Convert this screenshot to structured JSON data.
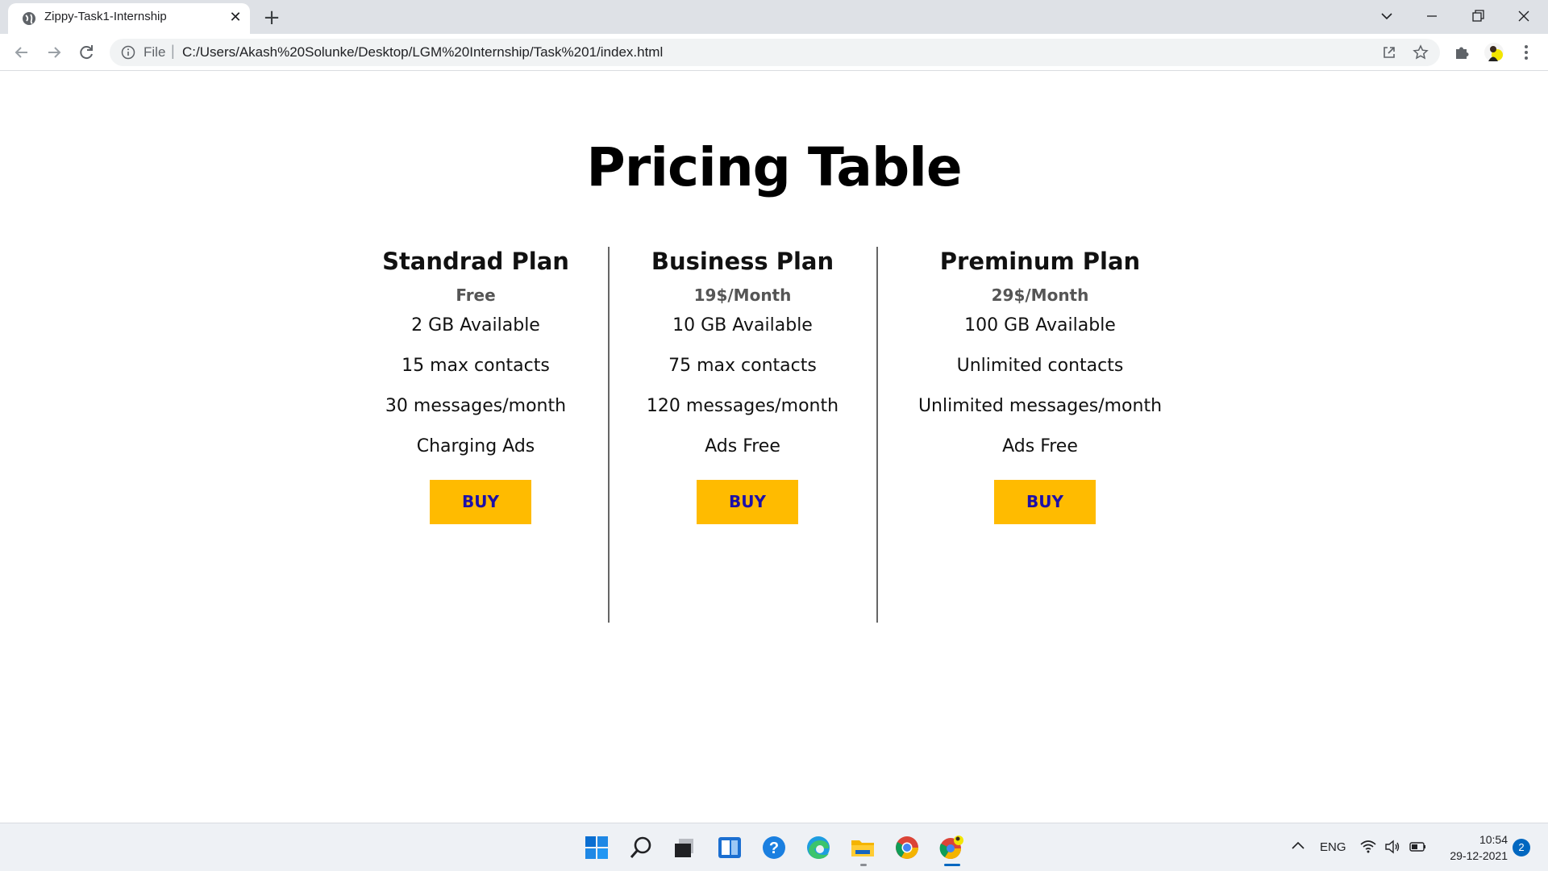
{
  "browser": {
    "tab_title": "Zippy-Task1-Internship",
    "tab_close": "✕",
    "new_tab": "+",
    "url_scheme": "File",
    "url_separator": "|",
    "url": "C:/Users/Akash%20Solunke/Desktop/LGM%20Internship/Task%201/index.html"
  },
  "page": {
    "title": "Pricing Table",
    "button_color": "#ffbb00",
    "button_text_color": "#1d10a8",
    "plans": [
      {
        "name": "Standrad Plan",
        "price": "Free",
        "features": [
          "2 GB Available",
          "15 max contacts",
          "30 messages/month",
          "Charging Ads"
        ],
        "button": "BUY"
      },
      {
        "name": "Business Plan",
        "price": "19$/Month",
        "features": [
          "10 GB Available",
          "75 max contacts",
          "120 messages/month",
          "Ads Free"
        ],
        "button": "BUY"
      },
      {
        "name": "Preminum Plan",
        "price": "29$/Month",
        "features": [
          "100 GB Available",
          "Unlimited contacts",
          "Unlimited messages/month",
          "Ads Free"
        ],
        "button": "BUY"
      }
    ]
  },
  "taskbar": {
    "apps": [
      "windows-start-icon",
      "search-icon",
      "task-view-icon",
      "widgets-icon",
      "help-icon",
      "edge-icon",
      "file-explorer-icon",
      "chrome-icon",
      "chrome-profile-icon"
    ],
    "language": "ENG",
    "time": "10:54",
    "date": "29-12-2021",
    "notification_count": "2"
  }
}
